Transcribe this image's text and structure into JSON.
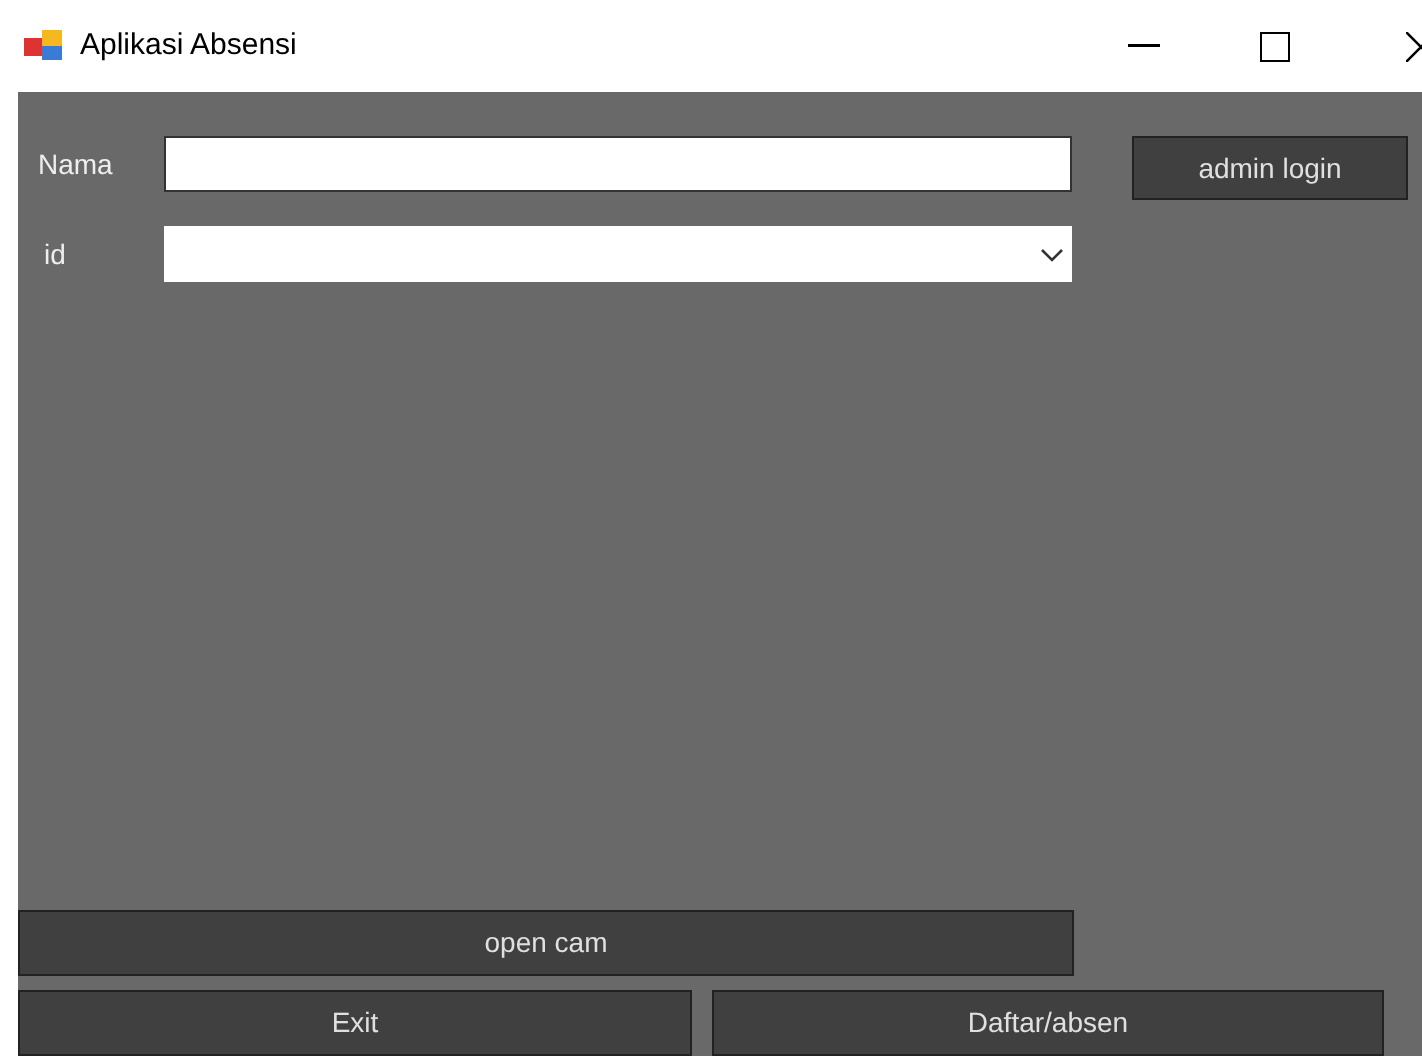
{
  "window": {
    "title": "Aplikasi Absensi"
  },
  "form": {
    "name_label": "Nama",
    "id_label": "id"
  },
  "buttons": {
    "admin_login": "admin login",
    "open_cam": "open cam",
    "exit": "Exit",
    "register": "Daftar/absen"
  }
}
